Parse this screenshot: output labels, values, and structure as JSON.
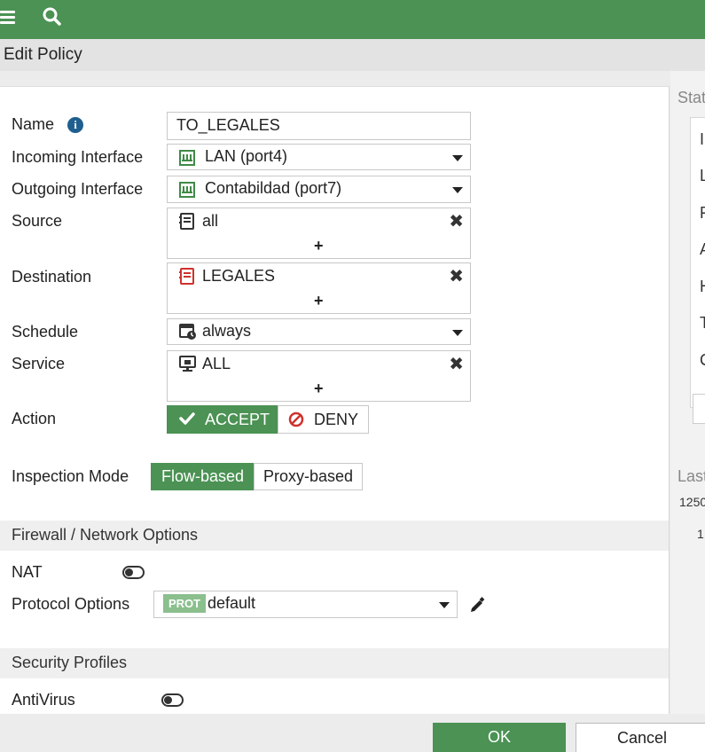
{
  "title": "Edit Policy",
  "form": {
    "name_label": "Name",
    "name_value": "TO_LEGALES",
    "incoming_label": "Incoming Interface",
    "incoming_value": "LAN (port4)",
    "outgoing_label": "Outgoing Interface",
    "outgoing_value": "Contabildad (port7)",
    "source_label": "Source",
    "source_value": "all",
    "destination_label": "Destination",
    "destination_value": "LEGALES",
    "schedule_label": "Schedule",
    "schedule_value": "always",
    "service_label": "Service",
    "service_value": "ALL",
    "action_label": "Action",
    "action_accept": "ACCEPT",
    "action_deny": "DENY",
    "action_selected": "ACCEPT",
    "inspection_label": "Inspection Mode",
    "inspection_flow": "Flow-based",
    "inspection_proxy": "Proxy-based",
    "inspection_selected": "Flow-based",
    "add_symbol": "+"
  },
  "firewall_section": {
    "title": "Firewall / Network Options",
    "nat_label": "NAT",
    "nat_enabled": false,
    "protocol_label": "Protocol Options",
    "protocol_badge": "PROT",
    "protocol_value": "default"
  },
  "security_section": {
    "title": "Security Profiles",
    "antivirus_label": "AntiVirus",
    "antivirus_enabled": false
  },
  "side_panel": {
    "status_fragment": "Stat",
    "letters": [
      "I",
      "L",
      "F",
      "A",
      "H",
      "T",
      "C"
    ],
    "last_fragment": "Last",
    "num1": "1250",
    "num2": "1"
  },
  "footer": {
    "ok_label": "OK",
    "cancel_label": "Cancel"
  },
  "colors": {
    "brand_green": "#4b9254",
    "deny_red": "#d0312d",
    "badge_green": "#8bbf8e"
  },
  "icons": [
    "menu-icon",
    "search-icon",
    "info-icon",
    "interface-port-icon",
    "address-icon",
    "address-group-icon",
    "schedule-icon",
    "service-icon",
    "remove-icon",
    "add-icon",
    "checkmark-icon",
    "deny-icon",
    "edit-pencil-icon"
  ]
}
